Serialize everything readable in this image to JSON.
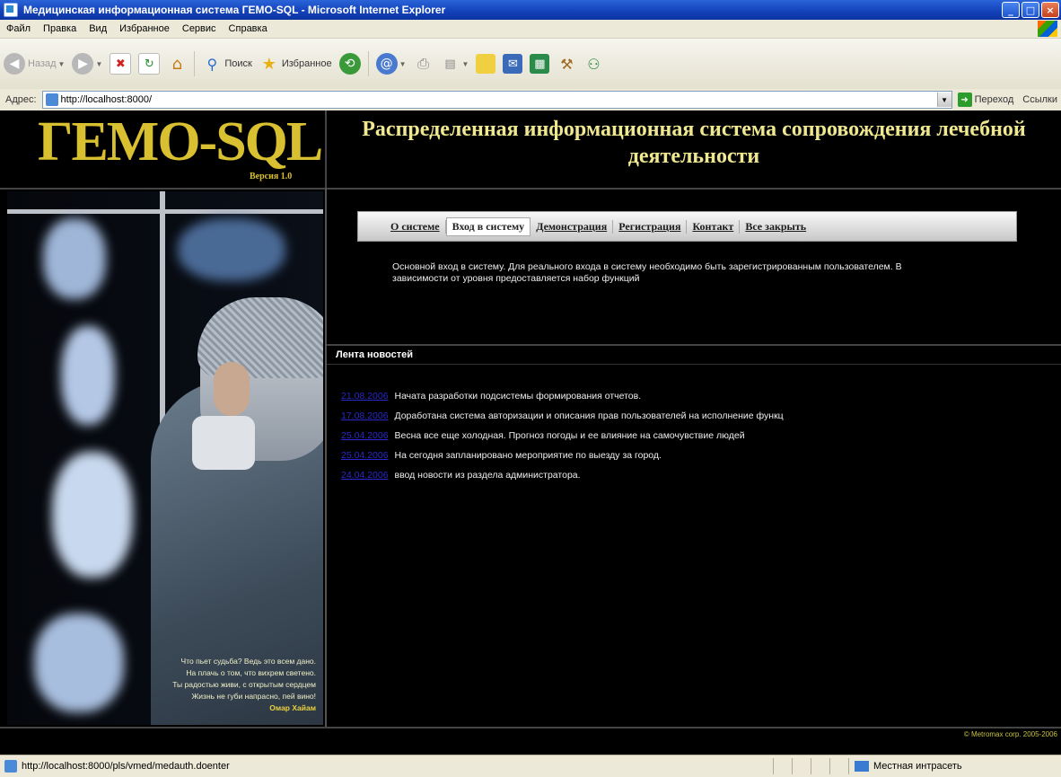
{
  "window": {
    "title": "Медицинская информационная система ГЕМО-SQL - Microsoft Internet Explorer",
    "min": "_",
    "max": "□",
    "close": "×"
  },
  "menu": [
    "Файл",
    "Правка",
    "Вид",
    "Избранное",
    "Сервис",
    "Справка"
  ],
  "toolbar": {
    "back": "Назад",
    "search": "Поиск",
    "favorites": "Избранное"
  },
  "address": {
    "label": "Адрес:",
    "url": "http://localhost:8000/",
    "go": "Переход",
    "links": "Ссылки"
  },
  "page": {
    "logo": "ГЕМО-SQL",
    "version": "Версия 1.0",
    "heading": "Распределенная информационная система сопровождения лечебной деятельности",
    "nav": [
      "О системе",
      "Вход в систему",
      "Демонстрация",
      "Регистрация",
      "Контакт",
      "Все закрыть"
    ],
    "description": "Основной вход в систему. Для реального входа в систему необходимо быть зарегистрированным пользователем. В зависимости от уровня предоставляется набор функций",
    "news_title": "Лента новостей",
    "news": [
      {
        "date": "21.08.2006",
        "text": "Начата разработки подсистемы формирования отчетов."
      },
      {
        "date": "17.08.2006",
        "text": "Доработана система авторизации и описания прав пользователей на исполнение функц"
      },
      {
        "date": "25.04.2006",
        "text": "Весна все еще холодная. Прогноз погоды и ее влияние на самочувствие людей"
      },
      {
        "date": "25.04.2006",
        "text": "На сегодня запланировано мероприятие по выезду за город."
      },
      {
        "date": "24.04.2006",
        "text": "ввод новости из раздела администратора."
      }
    ],
    "quote": [
      "Что пьет судьба? Ведь это всем дано.",
      "На плачь о том, что вихрем светено.",
      "Ты радостью живи, с открытым сердцем",
      "Жизнь не губи напрасно, пей вино!"
    ],
    "quote_author": "Омар Хайам",
    "copyright": "© Metromax corp. 2005-2006"
  },
  "status": {
    "url": "http://localhost:8000/pls/vmed/medauth.doenter",
    "zone": "Местная интрасеть"
  },
  "colors": {
    "logo": "#d8c030",
    "heading": "#f0e890",
    "news_date": "#2828c8",
    "background": "#000000"
  }
}
